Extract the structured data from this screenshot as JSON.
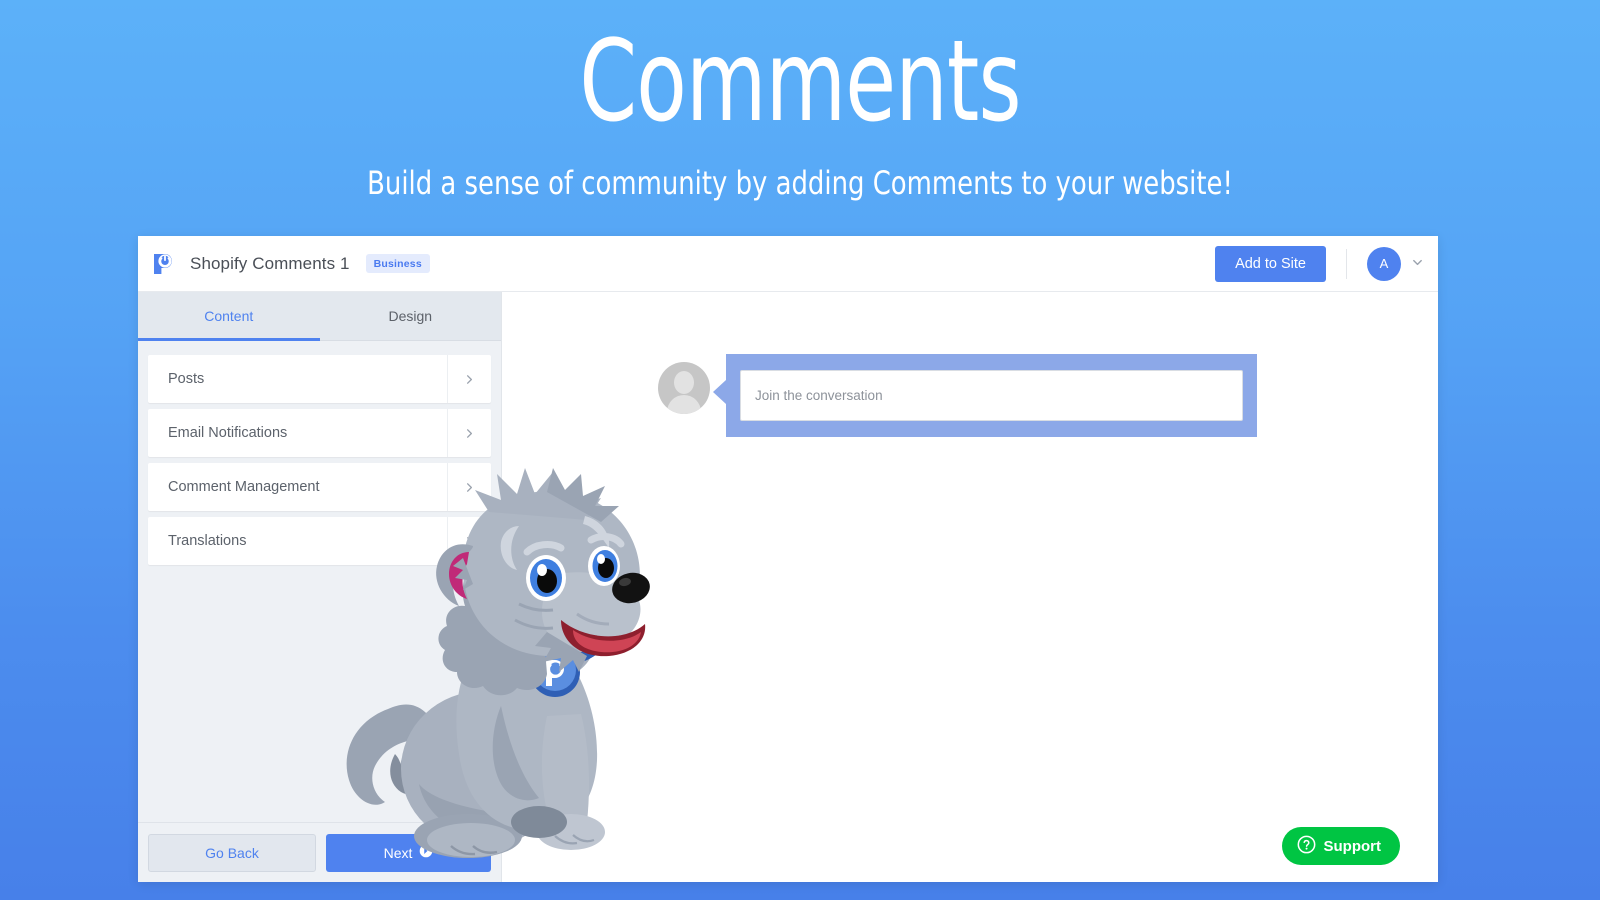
{
  "hero": {
    "title": "Comments",
    "subtitle": "Build a sense of community by adding Comments to your website!"
  },
  "colors": {
    "background_top": "#5cb1f9",
    "background_bottom": "#4780e9",
    "accent_blue": "#4f82ef",
    "badge_bg": "#e4ebfd",
    "badge_text": "#4a7af0",
    "support_green": "#00c543",
    "selection_blue": "#8ca8e8",
    "panel_bg": "#eef1f5",
    "tab_bar_bg": "#e3e8ee"
  },
  "app": {
    "header": {
      "logo_icon": "powr-logo-icon",
      "title": "Shopify Comments 1",
      "plan_badge": "Business",
      "add_to_site_label": "Add to Site",
      "avatar_initial": "A",
      "account_chevron_icon": "chevron-down-icon"
    },
    "tabs": [
      {
        "label": "Content",
        "active": true
      },
      {
        "label": "Design",
        "active": false
      }
    ],
    "menu_items": [
      {
        "label": "Posts",
        "chevron_icon": "chevron-right-icon"
      },
      {
        "label": "Email Notifications",
        "chevron_icon": "chevron-right-icon"
      },
      {
        "label": "Comment Management",
        "chevron_icon": "chevron-right-icon"
      },
      {
        "label": "Translations",
        "chevron_icon": "chevron-right-icon"
      }
    ],
    "footer": {
      "go_back_label": "Go Back",
      "next_label": "Next",
      "next_icon": "arrow-right-circle-icon"
    },
    "preview": {
      "avatar_icon": "default-user-avatar-icon",
      "composer_placeholder": "Join the conversation",
      "support_label": "Support",
      "support_icon": "question-circle-icon",
      "mascot_icon": "powr-dog-mascot"
    }
  }
}
